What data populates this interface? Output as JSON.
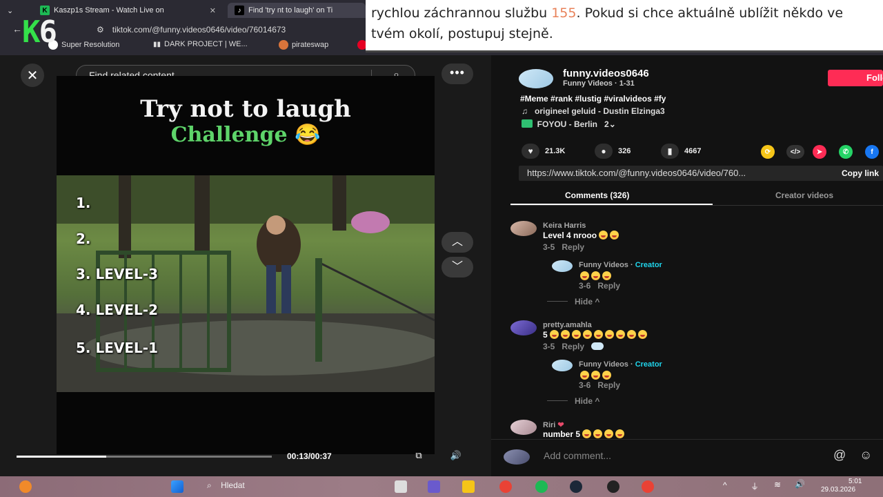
{
  "browser": {
    "tabs": [
      {
        "label": "Kaszp1s Stream - Watch Live on"
      },
      {
        "label": "Find 'try nt to laugh' on Ti"
      }
    ],
    "url": "tiktok.com/@funny.videos0646/video/76014673",
    "bookmarks": [
      "Super Resolution",
      "DARK PROJECT | WE...",
      "pirateswap"
    ]
  },
  "overlay_logo": {
    "k": "K",
    "six": "6"
  },
  "notice": {
    "line1_pre": "rychlou záchrannou službu ",
    "line1_number": "155",
    "line1_post": ". Pokud si chce aktuálně ublížit někdo ve",
    "line2": "tvém okolí, postupuj stejně."
  },
  "video": {
    "search_placeholder": "Find related content",
    "title": "Try not to laugh",
    "subtitle": "Challenge 😂",
    "levels": [
      "1.",
      "2.",
      "3. LEVEL-3",
      "4. LEVEL-2",
      "5. LEVEL-1"
    ],
    "time": "00:13/00:37",
    "progress": 0.35
  },
  "post": {
    "username": "funny.videos0646",
    "display": "Funny Videos · 1-31",
    "follow_label": "Follow",
    "hashtags": "#Meme #rank #lustig #viralvideos #fy",
    "sound": "origineel geluid - Dustin Elzinga3",
    "location": "FOYOU - Berlin",
    "location_count": "2",
    "likes": "21.3K",
    "comments": "326",
    "saves": "4667",
    "url": "https://www.tiktok.com/@funny.videos0646/video/760...",
    "copy_label": "Copy link"
  },
  "tabs": {
    "comments": "Comments (326)",
    "creator": "Creator videos"
  },
  "comments": [
    {
      "name": "Keira Harris",
      "text": "Level 4 nrooo",
      "date": "3-5",
      "reply": "Reply"
    },
    {
      "name": "Funny Videos",
      "creator_tag": "Creator",
      "date": "3-6",
      "reply": "Reply",
      "hide": "Hide"
    },
    {
      "name": "pretty.amahla",
      "text": "5",
      "date": "3-5",
      "reply": "Reply"
    },
    {
      "name": "Funny Videos",
      "creator_tag": "Creator",
      "date": "3-6",
      "reply": "Reply",
      "hide": "Hide"
    },
    {
      "name": "Riri",
      "text": "number 5"
    }
  ],
  "add_comment": {
    "placeholder": "Add comment..."
  },
  "taskbar": {
    "search": "Hledat",
    "time": "5:01",
    "date": "29.03.2026"
  }
}
